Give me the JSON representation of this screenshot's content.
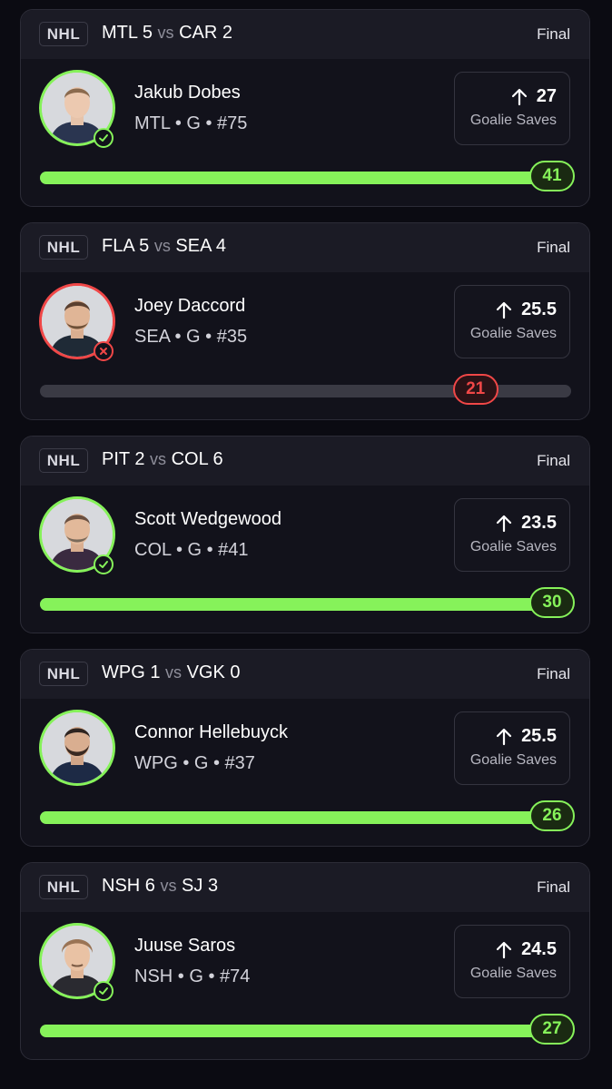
{
  "colors": {
    "hit": "#86f25a",
    "miss": "#f04747"
  },
  "cards": [
    {
      "league": "NHL",
      "away": "MTL",
      "away_score": "5",
      "vs": "vs",
      "home": "CAR",
      "home_score": "2",
      "status": "Final",
      "player": "Jakub Dobes",
      "meta": "MTL • G • #75",
      "line_direction_icon": "arrow-up-icon",
      "line": "27",
      "stat": "Goalie Saves",
      "result": "41",
      "outcome": "hit",
      "progress": 1.0
    },
    {
      "league": "NHL",
      "away": "FLA",
      "away_score": "5",
      "vs": "vs",
      "home": "SEA",
      "home_score": "4",
      "status": "Final",
      "player": "Joey Daccord",
      "meta": "SEA • G • #35",
      "line_direction_icon": "arrow-up-icon",
      "line": "25.5",
      "stat": "Goalie Saves",
      "result": "21",
      "outcome": "miss",
      "progress": 0.82
    },
    {
      "league": "NHL",
      "away": "PIT",
      "away_score": "2",
      "vs": "vs",
      "home": "COL",
      "home_score": "6",
      "status": "Final",
      "player": "Scott Wedgewood",
      "meta": "COL • G • #41",
      "line_direction_icon": "arrow-up-icon",
      "line": "23.5",
      "stat": "Goalie Saves",
      "result": "30",
      "outcome": "hit",
      "progress": 1.0
    },
    {
      "league": "NHL",
      "away": "WPG",
      "away_score": "1",
      "vs": "vs",
      "home": "VGK",
      "home_score": "0",
      "status": "Final",
      "player": "Connor Hellebuyck",
      "meta": "WPG • G • #37",
      "line_direction_icon": "arrow-up-icon",
      "line": "25.5",
      "stat": "Goalie Saves",
      "result": "26",
      "outcome": "hit",
      "progress": 1.0
    },
    {
      "league": "NHL",
      "away": "NSH",
      "away_score": "6",
      "vs": "vs",
      "home": "SJ",
      "home_score": "3",
      "status": "Final",
      "player": "Juuse Saros",
      "meta": "NSH • G • #74",
      "line_direction_icon": "arrow-up-icon",
      "line": "24.5",
      "stat": "Goalie Saves",
      "result": "27",
      "outcome": "hit",
      "progress": 1.0
    }
  ]
}
